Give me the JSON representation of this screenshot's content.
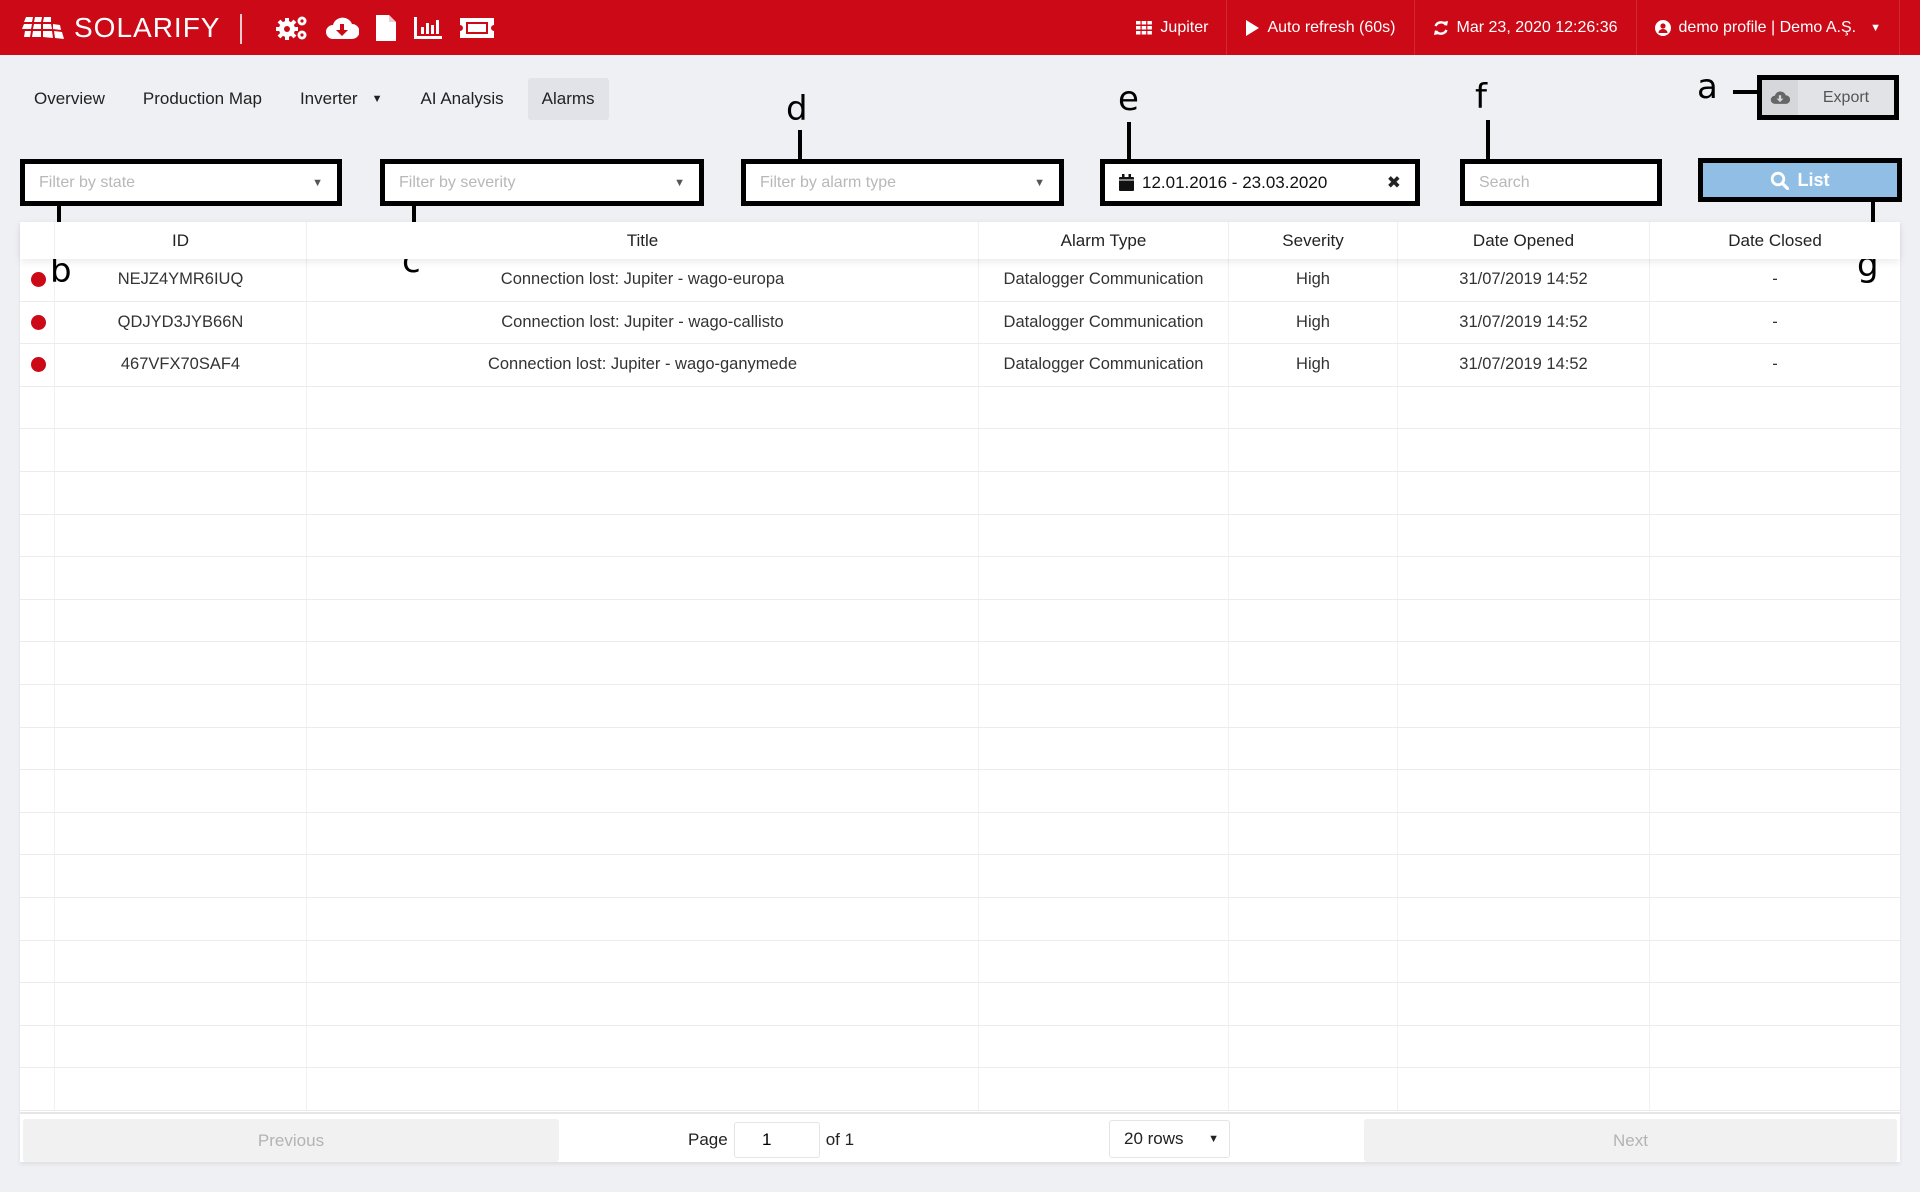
{
  "header": {
    "brand": "SOLARIFY",
    "tool_icons": [
      "gears-icon",
      "cloud-download-icon",
      "file-icon",
      "bar-chart-icon",
      "ticket-icon"
    ],
    "plant": "Jupiter",
    "auto_refresh": "Auto refresh (60s)",
    "datetime": "Mar 23, 2020 12:26:36",
    "profile": "demo profile | Demo A.Ş.",
    "brand_color": "#cc0a17"
  },
  "tabs": [
    {
      "label": "Overview",
      "active": false
    },
    {
      "label": "Production Map",
      "active": false
    },
    {
      "label": "Inverter",
      "active": false,
      "has_dropdown": true
    },
    {
      "label": "AI Analysis",
      "active": false
    },
    {
      "label": "Alarms",
      "active": true
    }
  ],
  "toolbar": {
    "export_label": "Export",
    "list_label": "List"
  },
  "filters": {
    "state_placeholder": "Filter by state",
    "severity_placeholder": "Filter by severity",
    "alarm_type_placeholder": "Filter by alarm type",
    "date_range": "12.01.2016 - 23.03.2020",
    "search_placeholder": "Search"
  },
  "annotations": {
    "a": "a",
    "b": "b",
    "c": "c",
    "d": "d",
    "e": "e",
    "f": "f",
    "g": "g"
  },
  "table": {
    "columns": [
      "",
      "ID",
      "Title",
      "Alarm Type",
      "Severity",
      "Date Opened",
      "Date Closed"
    ],
    "rows": [
      {
        "status_color": "#cc0a17",
        "id": "NEJZ4YMR6IUQ",
        "title": "Connection lost: Jupiter - wago-europa",
        "alarm_type": "Datalogger Communication",
        "severity": "High",
        "date_opened": "31/07/2019 14:52",
        "date_closed": "-"
      },
      {
        "status_color": "#cc0a17",
        "id": "QDJYD3JYB66N",
        "title": "Connection lost: Jupiter - wago-callisto",
        "alarm_type": "Datalogger Communication",
        "severity": "High",
        "date_opened": "31/07/2019 14:52",
        "date_closed": "-"
      },
      {
        "status_color": "#cc0a17",
        "id": "467VFX70SAF4",
        "title": "Connection lost: Jupiter - wago-ganymede",
        "alarm_type": "Datalogger Communication",
        "severity": "High",
        "date_opened": "31/07/2019 14:52",
        "date_closed": "-"
      }
    ],
    "empty_row_count": 17
  },
  "pagination": {
    "previous_label": "Previous",
    "next_label": "Next",
    "page_label": "Page",
    "current_page": "1",
    "of_label": "of 1",
    "rows_option": "20 rows"
  }
}
